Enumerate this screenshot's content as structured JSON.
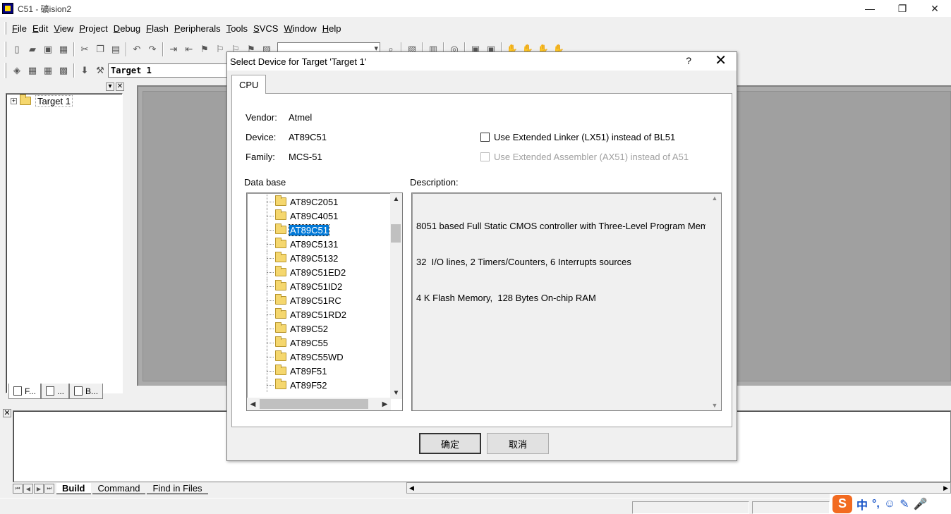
{
  "app": {
    "title": "C51 - 礦ision2",
    "window_controls": [
      "—",
      "❐",
      "✕"
    ]
  },
  "menubar": {
    "items": [
      {
        "label": "File",
        "u": "F",
        "rest": "ile"
      },
      {
        "label": "Edit",
        "u": "E",
        "rest": "dit"
      },
      {
        "label": "View",
        "u": "V",
        "rest": "iew"
      },
      {
        "label": "Project",
        "u": "P",
        "rest": "roject"
      },
      {
        "label": "Debug",
        "u": "D",
        "rest": "ebug"
      },
      {
        "label": "Flash",
        "u": "F",
        "rest": "lash"
      },
      {
        "label": "Peripherals",
        "u": "P",
        "rest": "eripherals"
      },
      {
        "label": "Tools",
        "u": "T",
        "rest": "ools"
      },
      {
        "label": "SVCS",
        "u": "S",
        "rest": "VCS"
      },
      {
        "label": "Window",
        "u": "W",
        "rest": "indow"
      },
      {
        "label": "Help",
        "u": "H",
        "rest": "elp"
      }
    ]
  },
  "toolbar": {
    "target": "Target 1"
  },
  "project": {
    "root": "Target 1",
    "tabs": [
      "F...",
      "...",
      "B..."
    ]
  },
  "output": {
    "tabs": [
      "Build",
      "Command",
      "Find in Files"
    ]
  },
  "ime": {
    "logo": "S",
    "items": [
      "中",
      "°,",
      "☺",
      "✎",
      "🎤"
    ]
  },
  "dialog": {
    "title": "Select Device for Target 'Target 1'",
    "help": "?",
    "close": "✕",
    "tab": "CPU",
    "vendor_label": "Vendor:",
    "vendor": "Atmel",
    "device_label": "Device:",
    "device": "AT89C51",
    "family_label": "Family:",
    "family": "MCS-51",
    "opt_linker": "Use Extended Linker (LX51) instead of BL51",
    "opt_assembler": "Use Extended Assembler (AX51) instead of A51",
    "database_label": "Data base",
    "description_label": "Description:",
    "devices": [
      "AT89C2051",
      "AT89C4051",
      "AT89C51",
      "AT89C5131",
      "AT89C5132",
      "AT89C51ED2",
      "AT89C51ID2",
      "AT89C51RC",
      "AT89C51RD2",
      "AT89C52",
      "AT89C55",
      "AT89C55WD",
      "AT89F51",
      "AT89F52"
    ],
    "selected_device": "AT89C51",
    "description_lines": [
      "8051 based Full Static CMOS controller with Three-Level Program Mem",
      "32  I/O lines, 2 Timers/Counters, 6 Interrupts sources",
      "4 K Flash Memory,  128 Bytes On-chip RAM"
    ],
    "ok": "确定",
    "cancel": "取消"
  }
}
